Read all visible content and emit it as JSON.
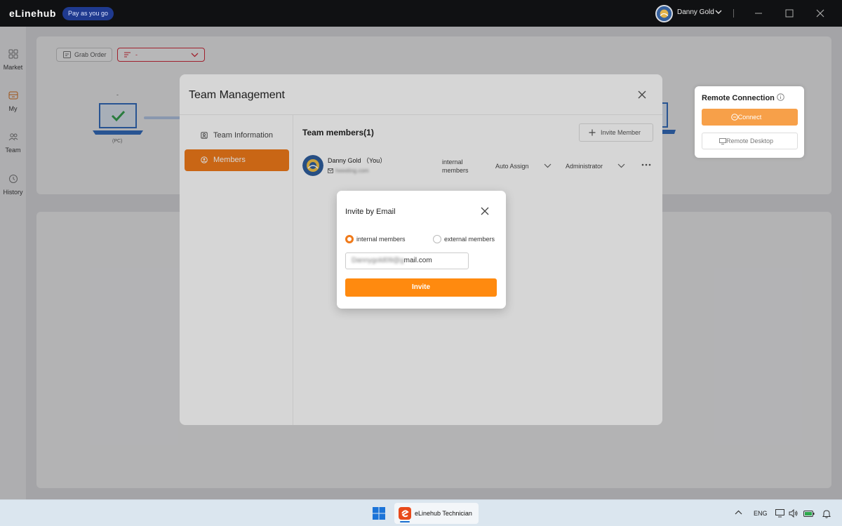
{
  "app": {
    "brand": "eLinehub",
    "plan_badge": "Pay as you go",
    "user_name": "Danny Gold"
  },
  "rail": [
    {
      "label": "Market",
      "icon": "grid-icon"
    },
    {
      "label": "My",
      "icon": "box-icon"
    },
    {
      "label": "Team",
      "icon": "team-icon"
    },
    {
      "label": "History",
      "icon": "clock-icon"
    }
  ],
  "background": {
    "grab_order_label": "Grab Order",
    "order_select_value": "-",
    "pc_dash": "-",
    "pc_label": "(PC)"
  },
  "remote": {
    "title": "Remote Connection",
    "connect_label": "Connect",
    "desktop_label": "Remote Desktop"
  },
  "team_modal": {
    "title": "Team Management",
    "nav": [
      {
        "label": "Team Information",
        "active": false
      },
      {
        "label": "Members",
        "active": true
      }
    ],
    "members_title": "Team members(1)",
    "invite_member_label": "Invite Member",
    "member": {
      "name": "Danny Gold （You）",
      "email": "heeeling.com",
      "type": "internal members",
      "assign": "Auto Assign",
      "role": "Administrator"
    }
  },
  "invite_dialog": {
    "title": "Invite by Email",
    "option_internal": "internal members",
    "option_external": "external members",
    "selected": "internal",
    "email_hidden": "Dannygold09@g",
    "email_visible": "mail.com",
    "invite_label": "Invite"
  },
  "taskbar": {
    "app_label": "eLinehub Technician",
    "lang": "ENG"
  },
  "colors": {
    "accent": "#f07a1a",
    "invite": "#ff8a0f",
    "titlebar": "#101113"
  }
}
